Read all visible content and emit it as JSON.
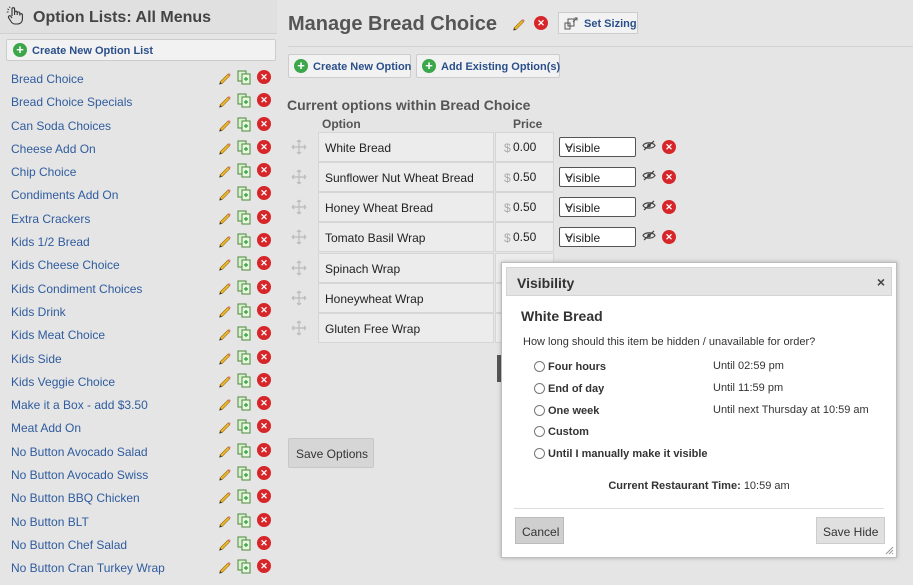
{
  "sidebar": {
    "title": "Option Lists: All Menus",
    "create_label": "Create New Option List",
    "items": [
      "Bread Choice",
      "Bread Choice Specials",
      "Can Soda Choices",
      "Cheese Add On",
      "Chip Choice",
      "Condiments Add On",
      "Extra Crackers",
      "Kids 1/2 Bread",
      "Kids Cheese Choice",
      "Kids Condiment Choices",
      "Kids Drink",
      "Kids Meat Choice",
      "Kids Side",
      "Kids Veggie Choice",
      "Make it a Box - add $3.50",
      "Meat Add On",
      "No Button Avocado Salad",
      "No Button Avocado Swiss",
      "No Button BBQ Chicken",
      "No Button BLT",
      "No Button Chef Salad",
      "No Button Cran Turkey Wrap"
    ]
  },
  "header": {
    "title": "Manage Bread Choice",
    "set_sizing": "Set Sizing"
  },
  "toolbar": {
    "create_new_option": "Create New Option",
    "add_existing": "Add Existing Option(s)"
  },
  "options": {
    "section_title": "Current options within Bread Choice",
    "col_option": "Option",
    "col_price": "Price",
    "currency": "$",
    "rows": [
      {
        "name": "White Bread",
        "price": "0.00",
        "visibility": "Visible"
      },
      {
        "name": "Sunflower Nut Wheat Bread",
        "price": "0.50",
        "visibility": "Visible"
      },
      {
        "name": "Honey Wheat Bread",
        "price": "0.50",
        "visibility": "Visible"
      },
      {
        "name": "Tomato Basil Wrap",
        "price": "0.50",
        "visibility": "Visible"
      },
      {
        "name": "Spinach Wrap"
      },
      {
        "name": "Honeywheat Wrap"
      },
      {
        "name": "Gluten Free Wrap"
      }
    ],
    "save_label": "Save Options"
  },
  "modal": {
    "title": "Visibility",
    "close": "×",
    "item_name": "White Bread",
    "question": "How long should this item be hidden / unavailable for order?",
    "choices": [
      {
        "label": "Four hours",
        "until": "Until 02:59 pm"
      },
      {
        "label": "End of day",
        "until": "Until 11:59 pm"
      },
      {
        "label": "One week",
        "until": "Until next Thursday at 10:59 am"
      },
      {
        "label": "Custom",
        "until": ""
      },
      {
        "label": "Until I manually make it visible",
        "until": ""
      }
    ],
    "time_label": "Current Restaurant Time:",
    "time_value": "10:59 am",
    "cancel": "Cancel",
    "save": "Save Hide"
  },
  "colors": {
    "link": "#2f5c9e",
    "accent_green": "#3ca64a",
    "delete_red": "#d7262a"
  }
}
